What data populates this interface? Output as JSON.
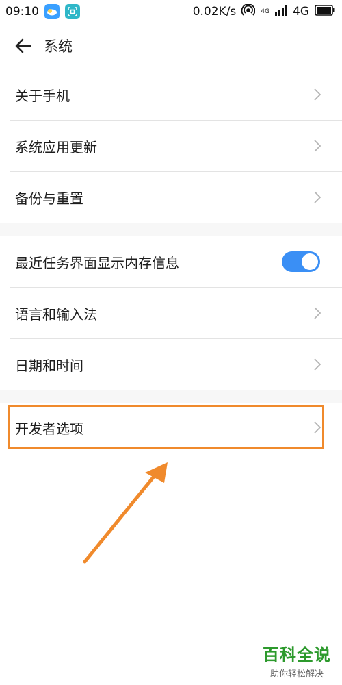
{
  "status_bar": {
    "time": "09:10",
    "net_speed": "0.02K/s",
    "signal_small": "4G",
    "network": "4G"
  },
  "header": {
    "title": "系统"
  },
  "sections": [
    {
      "items": [
        {
          "label": "关于手机"
        },
        {
          "label": "系统应用更新"
        },
        {
          "label": "备份与重置"
        }
      ]
    },
    {
      "items": [
        {
          "label": "最近任务界面显示内存信息",
          "toggle": "on"
        },
        {
          "label": "语言和输入法"
        },
        {
          "label": "日期和时间"
        }
      ]
    },
    {
      "items": [
        {
          "label": "开发者选项"
        }
      ]
    }
  ],
  "colors": {
    "toggle_on": "#3a8ff5",
    "annotation": "#f08a2c",
    "watermark": "#2d9a2d"
  },
  "watermark": {
    "title": "百科全说",
    "subtitle": "助你轻松解决"
  }
}
